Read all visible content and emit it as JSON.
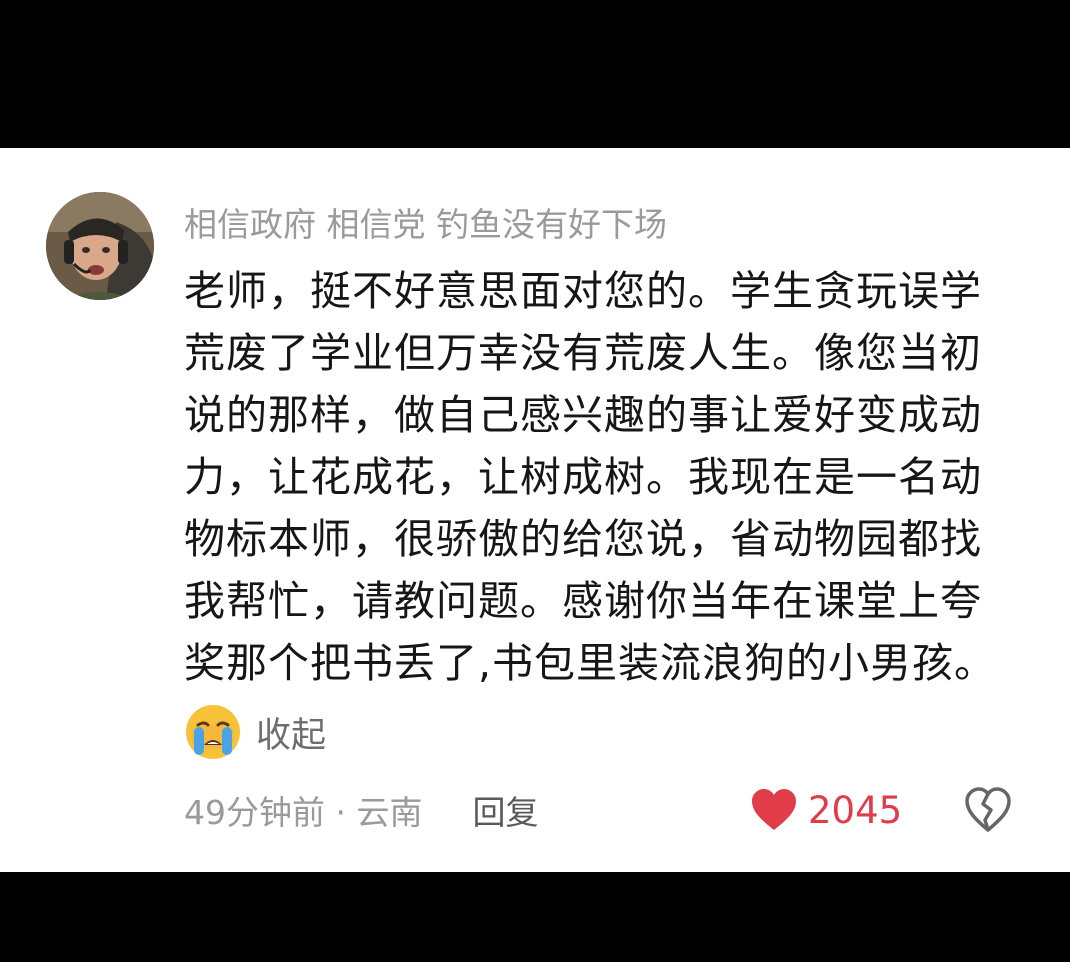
{
  "comment": {
    "username": "相信政府 相信党 钓鱼没有好下场",
    "body_lines": [
      "老师，挺不好意思面对您的。学生贪玩误学",
      "荒废了学业但万幸没有荒废人生。像您当初",
      "说的那样，做自己感兴趣的事让爱好变成动",
      "力，让花成花，让树成树。我现在是一名动",
      "物标本师，很骄傲的给您说，省动物园都找",
      "我帮忙，请教问题。感谢你当年在课堂上夸",
      "奖那个把书丢了,书包里装流浪狗的小男孩。"
    ],
    "collapse_label": "收起",
    "time_location": "49分钟前 · 云南",
    "reply_label": "回复",
    "like_count": "2045",
    "colors": {
      "like_red": "#e03c4a",
      "muted_text": "#9a9a9a",
      "body_text": "#161616"
    }
  }
}
